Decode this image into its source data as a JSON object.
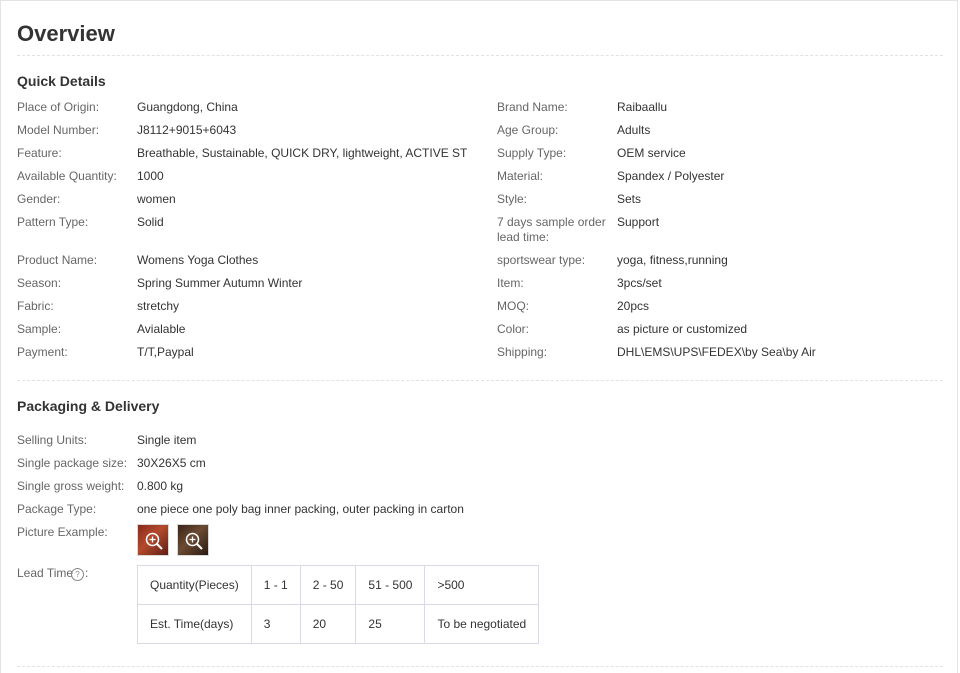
{
  "title": "Overview",
  "quick_details": {
    "heading": "Quick Details",
    "left": [
      {
        "key": "Place of Origin:",
        "value": "Guangdong, China"
      },
      {
        "key": "Model Number:",
        "value": "J8112+9015+6043"
      },
      {
        "key": "Feature:",
        "value": "Breathable, Sustainable, QUICK DRY, lightweight, ACTIVE ST..."
      },
      {
        "key": "Available Quantity:",
        "value": "1000"
      },
      {
        "key": "Gender:",
        "value": "women"
      },
      {
        "key": "Pattern Type:",
        "value": "Solid"
      },
      {
        "key": "Product Name:",
        "value": "Womens Yoga Clothes"
      },
      {
        "key": "Season:",
        "value": "Spring Summer Autumn Winter"
      },
      {
        "key": "Fabric:",
        "value": "stretchy"
      },
      {
        "key": "Sample:",
        "value": "Avialable"
      },
      {
        "key": "Payment:",
        "value": "T/T,Paypal"
      }
    ],
    "right": [
      {
        "key": "Brand Name:",
        "value": "Raibaallu"
      },
      {
        "key": "Age Group:",
        "value": "Adults"
      },
      {
        "key": "Supply Type:",
        "value": "OEM service"
      },
      {
        "key": "Material:",
        "value": "Spandex / Polyester"
      },
      {
        "key": "Style:",
        "value": "Sets"
      },
      {
        "key": "7 days sample order lead time:",
        "value": "Support"
      },
      {
        "key": "sportswear type:",
        "value": "yoga, fitness,running"
      },
      {
        "key": "Item:",
        "value": "3pcs/set"
      },
      {
        "key": "MOQ:",
        "value": "20pcs"
      },
      {
        "key": "Color:",
        "value": "as picture or customized"
      },
      {
        "key": "Shipping:",
        "value": "DHL\\EMS\\UPS\\FEDEX\\by Sea\\by Air"
      }
    ]
  },
  "packaging": {
    "heading": "Packaging & Delivery",
    "rows": [
      {
        "key": "Selling Units:",
        "value": "Single item"
      },
      {
        "key": "Single package size:",
        "value": "30X26X5 cm"
      },
      {
        "key": "Single gross weight:",
        "value": "0.800 kg"
      },
      {
        "key": "Package Type:",
        "value": "one piece one poly bag inner packing, outer packing in carton"
      }
    ],
    "picture_label": "Picture Example:",
    "picture_icons": [
      "zoom-in-icon",
      "zoom-in-icon"
    ],
    "lead_time": {
      "label": "Lead Time",
      "help_glyph": "?",
      "colon": ":",
      "rows": [
        [
          "Quantity(Pieces)",
          "1 - 1",
          "2 - 50",
          "51 - 500",
          ">500"
        ],
        [
          "Est. Time(days)",
          "3",
          "20",
          "25",
          "To be negotiated"
        ]
      ]
    }
  },
  "colors": {
    "divider": "#e2e2e2",
    "key_text": "#666666",
    "value_text": "#333333",
    "table_border": "#d9d9e8"
  }
}
